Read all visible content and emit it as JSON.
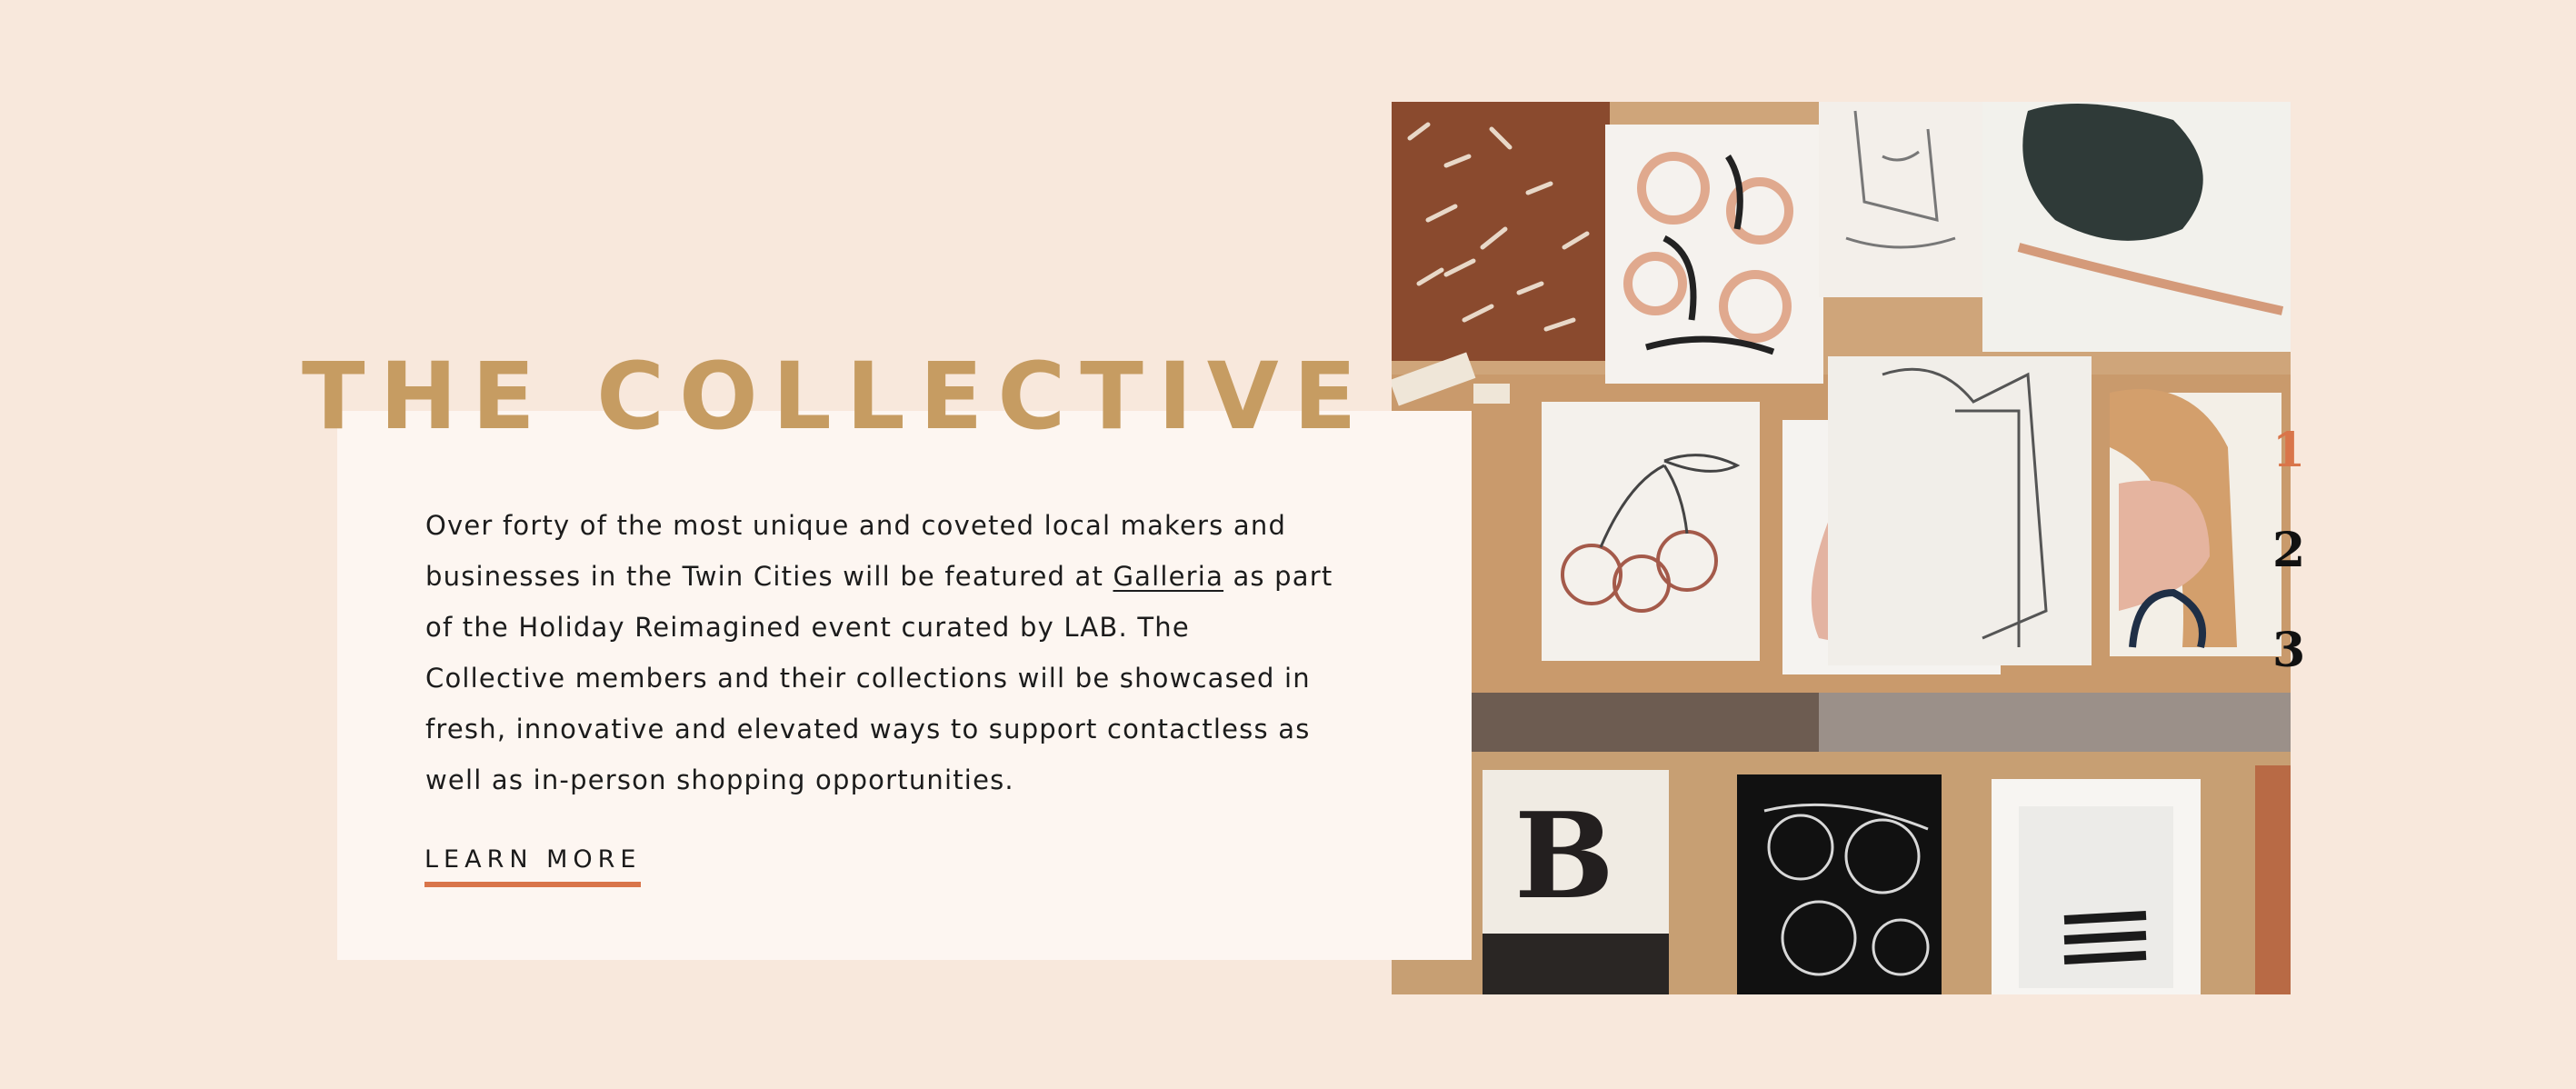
{
  "section": {
    "title": "THE COLLECTIVE",
    "body_before_link": "Over forty of the most unique and coveted local makers and businesses in the Twin Cities will be featured at ",
    "link_text": "Galleria",
    "body_after_link": " as part of the Holiday Reimagined event curated by LAB. The Collective members and their collections will be showcased in fresh, innovative and elevated ways to support contactless as well as in-person shopping opportunities.",
    "cta_label": "LEARN MORE"
  },
  "slider": {
    "pages": [
      "1",
      "2",
      "3"
    ],
    "active_index": 0
  },
  "colors": {
    "background": "#f8e8dc",
    "card": "#fdf6f1",
    "heading": "#c69c62",
    "accent": "#d9754a",
    "text": "#1c1c1c"
  }
}
